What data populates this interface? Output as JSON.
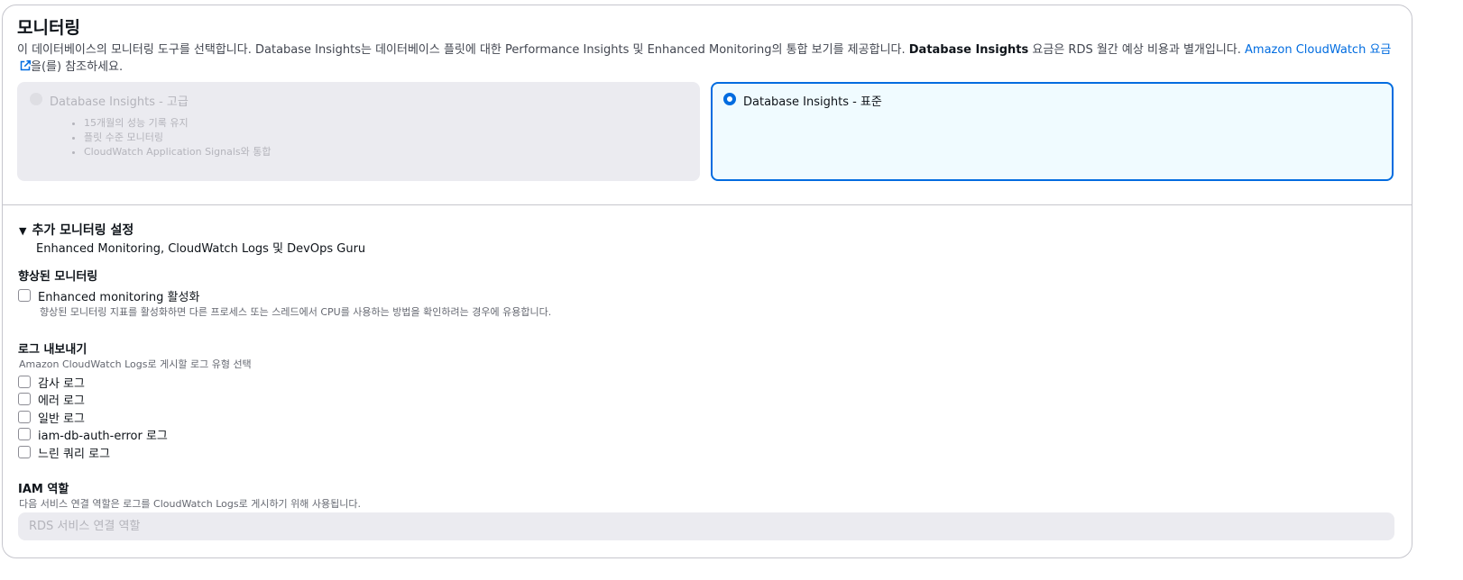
{
  "monitoring": {
    "title": "모니터링",
    "desc_part1": "이 데이터베이스의 모니터링 도구를 선택합니다. Database Insights는 데이터베이스 플릿에 대한 Performance Insights 및 Enhanced Monitoring의 통합 보기를 제공합니다. ",
    "desc_bold": "Database Insights",
    "desc_part2": " 요금은 RDS 월간 예상 비용과 별개입니다. ",
    "desc_link": "Amazon CloudWatch 요금",
    "desc_part3": "을(를) 참조하세요.",
    "options": [
      {
        "label": "Database Insights - 고급",
        "selected": false,
        "disabled": true,
        "bullets": [
          "15개월의 성능 기록 유지",
          "플릿 수준 모니터링",
          "CloudWatch Application Signals와 통합"
        ]
      },
      {
        "label": "Database Insights - 표준",
        "selected": true,
        "disabled": false
      }
    ]
  },
  "additional": {
    "caret": "▼",
    "title": "추가 모니터링 설정",
    "subtitle": "Enhanced Monitoring, CloudWatch Logs 및 DevOps Guru"
  },
  "enhanced": {
    "title": "향상된 모니터링",
    "checkbox_label": "Enhanced monitoring 활성화",
    "checked": false,
    "help": "향상된 모니터링 지표를 활성화하면 다른 프로세스 또는 스레드에서 CPU를 사용하는 방법을 확인하려는 경우에 유용합니다."
  },
  "logs": {
    "title": "로그 내보내기",
    "desc": "Amazon CloudWatch Logs로 게시할 로그 유형 선택",
    "items": [
      {
        "label": "감사 로그",
        "checked": false
      },
      {
        "label": "에러 로그",
        "checked": false
      },
      {
        "label": "일반 로그",
        "checked": false
      },
      {
        "label": "iam-db-auth-error 로그",
        "checked": false
      },
      {
        "label": "느린 쿼리 로그",
        "checked": false
      }
    ]
  },
  "iam": {
    "title": "IAM 역할",
    "desc": "다음 서비스 연결 역할은 로그를 CloudWatch Logs로 게시하기 위해 사용됩니다.",
    "value": "RDS 서비스 연결 역할"
  },
  "colors": {
    "accent": "#006ce0",
    "selected_bg": "#f0fbff",
    "disabled_bg": "#ebebf0"
  },
  "icons": {
    "external_link": "external-link-icon"
  }
}
